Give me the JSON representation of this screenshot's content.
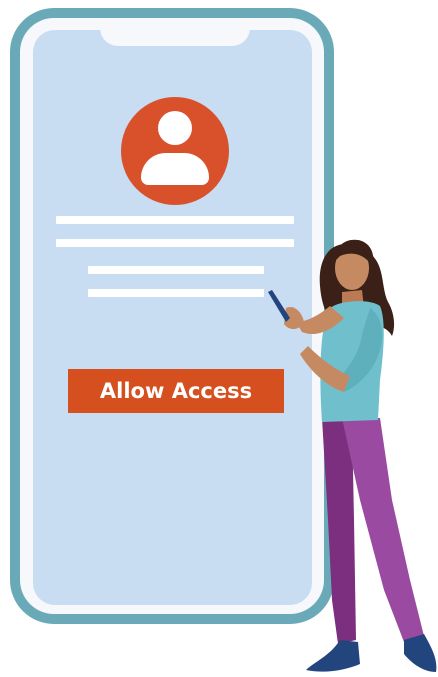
{
  "access_prompt": {
    "button_label": "Allow Access"
  },
  "icons": {
    "profile": "user-avatar-icon",
    "phone_device": "smartphone-icon"
  },
  "illustration": {
    "figure": "woman-holding-phone"
  },
  "colors": {
    "accent": "#d9512a",
    "button": "#d64f1f",
    "phone_frame": "#6aaab8",
    "screen": "#c8dcf2",
    "shirt": "#6fc0cc",
    "pants": "#8c3a8e",
    "hair": "#3a2016",
    "skin": "#c68a62",
    "shoes": "#23457d"
  }
}
